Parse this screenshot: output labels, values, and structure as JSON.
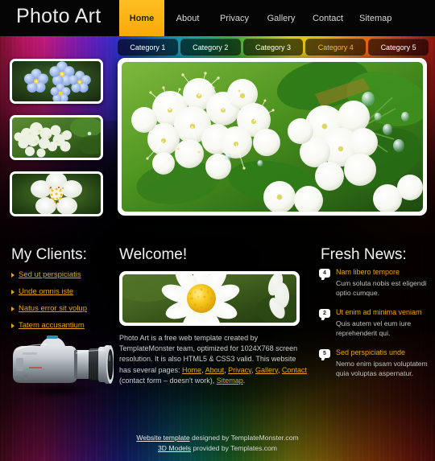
{
  "site": {
    "logo": "Photo Art"
  },
  "nav": {
    "items": [
      {
        "label": "Home",
        "active": true
      },
      {
        "label": "About",
        "active": false
      },
      {
        "label": "Privacy",
        "active": false
      },
      {
        "label": "Gallery",
        "active": false
      },
      {
        "label": "Contact",
        "active": false
      },
      {
        "label": "Sitemap",
        "active": false
      }
    ]
  },
  "categories": {
    "items": [
      {
        "label": "Category 1",
        "highlight": false
      },
      {
        "label": "Category 2",
        "highlight": false
      },
      {
        "label": "Category 3",
        "highlight": false
      },
      {
        "label": "Category 4",
        "highlight": true
      },
      {
        "label": "Category 5",
        "highlight": false
      }
    ]
  },
  "thumbnails": [
    {
      "name": "blue-forget-me-not-flowers"
    },
    {
      "name": "white-blossom-cluster"
    },
    {
      "name": "white-flower-yellow-stamens"
    }
  ],
  "hero": {
    "name": "white-blossoms-with-water-droplets"
  },
  "clients": {
    "heading": "My Clients:",
    "items": [
      {
        "label": "Sed ut perspiciatis"
      },
      {
        "label": "Unde omnis iste"
      },
      {
        "label": "Natus error sit volup"
      },
      {
        "label": "Tatem accusantium"
      }
    ],
    "image": "dslr-camera-with-telephoto-lens"
  },
  "welcome": {
    "heading": "Welcome!",
    "image": "white-daisy-yellow-center",
    "paragraph": {
      "part1": "Photo Art is a free web template created by TemplateMonster team, optimized for 1024X768 screen resolution. It is also HTML5 & CSS3 valid. This website has several pages: ",
      "link_home": "Home",
      "sep1": ", ",
      "link_about": "About",
      "sep2": ", ",
      "link_privacy": "Privacy",
      "sep3": ", ",
      "link_gallery": "Gallery",
      "sep4": ", ",
      "link_contact": "Contact",
      "part2": " (contact form – doesn't work), ",
      "link_sitemap": "Sitemap",
      "part3": "."
    }
  },
  "news": {
    "heading": "Fresh News:",
    "items": [
      {
        "badge": "4",
        "title": "Nam libero tempore",
        "description": "Cum soluta nobis est eligendi optio cumque."
      },
      {
        "badge": "2",
        "title": "Ut enim ad minima veniam",
        "description": "Quis autem vel eum iure reprehenderit qui."
      },
      {
        "badge": "5",
        "title": "Sed perspiciatis unde",
        "description": "Nemo enim ipsam voluptatem quia voluptas aspernatur."
      }
    ]
  },
  "footer": {
    "line1_link": "Website template",
    "line1_text": " designed by TemplateMonster.com",
    "line2_link": "3D Models",
    "line2_text": " provided by Templates.com"
  },
  "colors": {
    "accent": "#f9a908",
    "link": "#e5a617",
    "header_bg": "#050505",
    "text": "#cfcfcf"
  }
}
